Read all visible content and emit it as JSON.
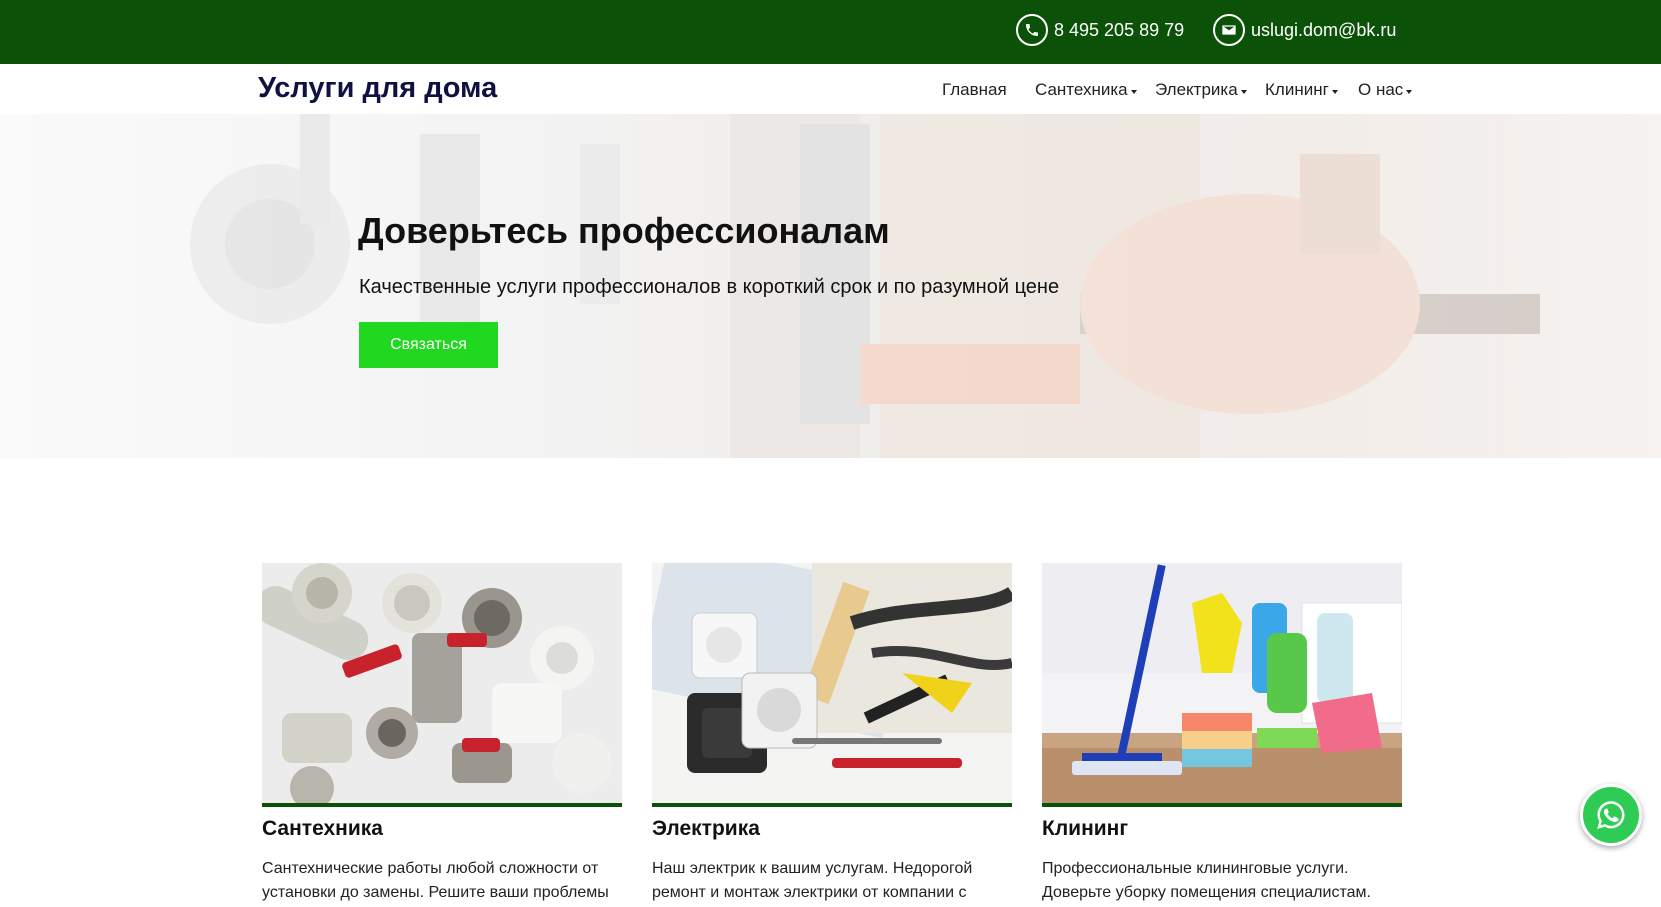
{
  "topbar": {
    "phone": "8 495 205 89 79",
    "email": "uslugi.dom@bk.ru",
    "phone_icon": "phone-icon",
    "email_icon": "envelope-icon"
  },
  "header": {
    "logo": "Услуги для дома",
    "nav": [
      {
        "label": "Главная",
        "dropdown": false
      },
      {
        "label": "Сантехника",
        "dropdown": true
      },
      {
        "label": "Электрика",
        "dropdown": true
      },
      {
        "label": "Клининг",
        "dropdown": true
      },
      {
        "label": "О нас",
        "dropdown": true
      }
    ]
  },
  "hero": {
    "title": "Доверьтесь профессионалам",
    "subtitle": "Качественные услуги профессионалов в короткий срок и по разумной цене",
    "button": "Связаться"
  },
  "cards": [
    {
      "title": "Сантехника",
      "desc_line1": "Сантехнические работы любой сложности от",
      "desc_line2": "установки до замены. Решите ваши проблемы"
    },
    {
      "title": "Электрика",
      "desc_line1": "Наш электрик к вашим услугам. Недорогой",
      "desc_line2": "ремонт и монтаж электрики от компании с"
    },
    {
      "title": "Клининг",
      "desc_line1": "Профессиональные клининговые услуги.",
      "desc_line2": "Доверьте уборку помещения специалистам."
    }
  ],
  "floating": {
    "icon": "whatsapp-icon"
  },
  "colors": {
    "topbar": "#0b5208",
    "accent_button": "#1fd81f",
    "logo": "#0f1240",
    "card_bar": "#0b5208"
  }
}
